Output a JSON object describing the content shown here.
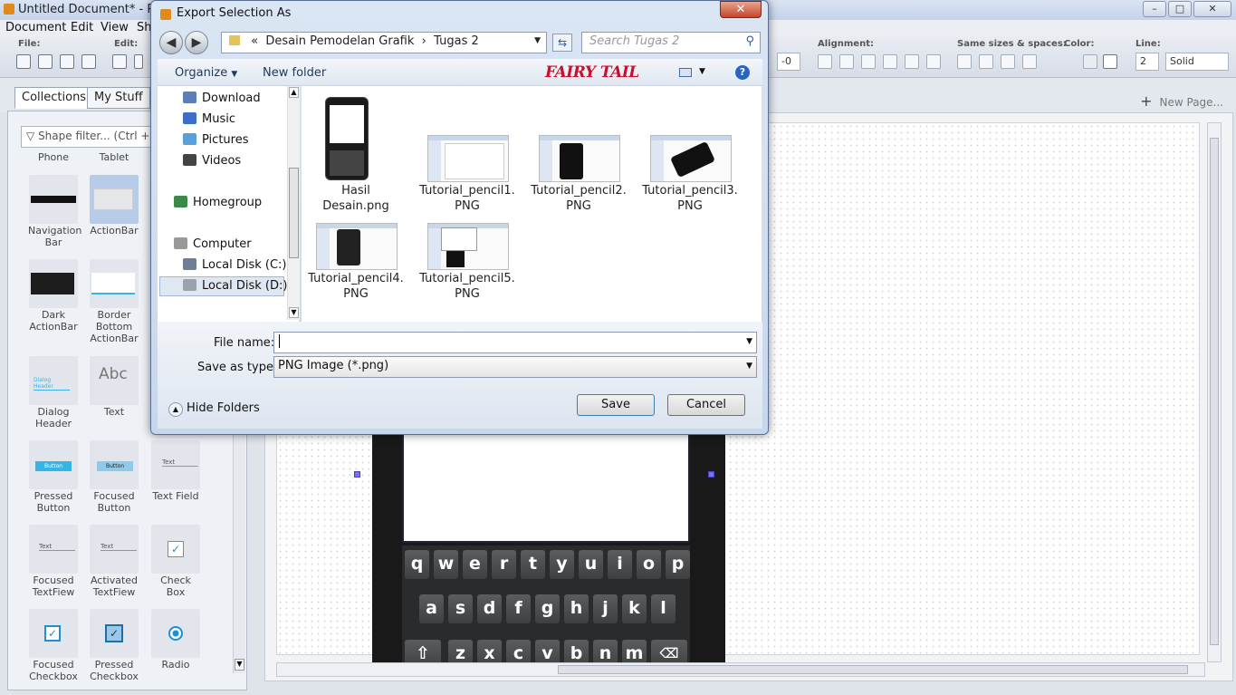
{
  "app": {
    "title": "Untitled Document* - Pe",
    "menu": [
      "Document",
      "Edit",
      "View",
      "Sh"
    ],
    "toolbar_sections": {
      "file": "File:",
      "edit": "Edit:",
      "alignment": "Alignment:",
      "same_sizes": "Same sizes & spaces:",
      "color": "Color:",
      "line": "Line:"
    },
    "spinner_value": "-0",
    "line_width": "2",
    "line_style": "Solid",
    "tabs": [
      "Collections",
      "My Stuff"
    ],
    "new_page": "New Page...",
    "shape_filter_placeholder": "Shape filter... (Ctrl +"
  },
  "shapes": [
    {
      "label": "Phone"
    },
    {
      "label": "Tablet"
    },
    {
      "label": "Navigation Bar"
    },
    {
      "label": "ActionBar"
    },
    {
      "label": "Dark ActionBar"
    },
    {
      "label": "Border Bottom ActionBar"
    },
    {
      "label": "Dialog Header"
    },
    {
      "label": "Text"
    },
    {
      "label": "Pressed Button"
    },
    {
      "label": "Focused Button"
    },
    {
      "label": "Text Field"
    },
    {
      "label": "Focused TextFiew"
    },
    {
      "label": "Activated TextFiew"
    },
    {
      "label": "Check Box"
    },
    {
      "label": "Focused Checkbox"
    },
    {
      "label": "Pressed Checkbox"
    },
    {
      "label": "Radio"
    }
  ],
  "shape_previews": {
    "dialog_header": "Dialog Header",
    "abc": "Abc",
    "button": "Button",
    "text": "Text"
  },
  "keyboard": {
    "row1": [
      "q",
      "w",
      "e",
      "r",
      "t",
      "y",
      "u",
      "i",
      "o",
      "p"
    ],
    "row2": [
      "a",
      "s",
      "d",
      "f",
      "g",
      "h",
      "j",
      "k",
      "l"
    ],
    "row3": [
      "z",
      "x",
      "c",
      "v",
      "b",
      "n",
      "m"
    ]
  },
  "dialog": {
    "title": "Export Selection As",
    "path": [
      "«",
      "Desain Pemodelan Grafik",
      "›",
      "Tugas 2"
    ],
    "search_placeholder": "Search Tugas 2",
    "organize": "Organize",
    "new_folder": "New folder",
    "nav": [
      "Download",
      "Music",
      "Pictures",
      "Videos",
      "Homegroup",
      "Computer",
      "Local Disk (C:)",
      "Local Disk (D:)"
    ],
    "files": [
      {
        "name": "Hasil Desain.png"
      },
      {
        "name": "Tutorial_pencil1.PNG"
      },
      {
        "name": "Tutorial_pencil2.PNG"
      },
      {
        "name": "Tutorial_pencil3.PNG"
      },
      {
        "name": "Tutorial_pencil4.PNG"
      },
      {
        "name": "Tutorial_pencil5.PNG"
      }
    ],
    "file_name_label": "File name:",
    "file_name_value": "",
    "save_type_label": "Save as type:",
    "save_type_value": "PNG Image (*.png)",
    "hide_folders": "Hide Folders",
    "save": "Save",
    "cancel": "Cancel",
    "logo_text": "FAIRY TAIL"
  }
}
